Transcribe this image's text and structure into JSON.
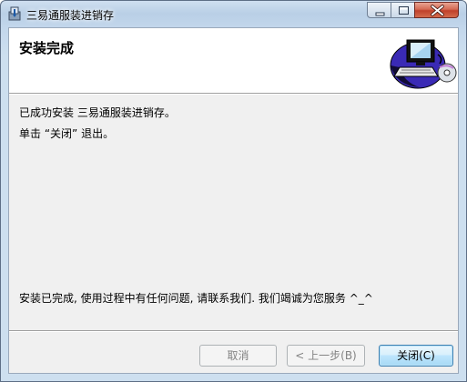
{
  "window": {
    "title": "三易通服装进销存",
    "controls": {
      "minimize": "minimize",
      "maximize": "maximize",
      "close": "close"
    }
  },
  "header": {
    "title": "安装完成",
    "graphic": "computer-with-disc-icon"
  },
  "messages": {
    "installed": "已成功安装 三易通服装进销存。",
    "instruction": "单击 “关闭” 退出。",
    "thanks": "安装已完成, 使用过程中有任何问题, 请联系我们. 我们竭诚为您服务  ^_^"
  },
  "buttons": {
    "cancel": {
      "label": "取消",
      "enabled": false
    },
    "back": {
      "label": "< 上一步(B)",
      "enabled": false
    },
    "close": {
      "label": "关闭(C)",
      "enabled": true,
      "default": true
    }
  },
  "colors": {
    "titlebar": "#c3d7ec",
    "close_button": "#c94a33",
    "dialog_background": "#f0f0f0",
    "default_button_border": "#3c7fb1"
  }
}
